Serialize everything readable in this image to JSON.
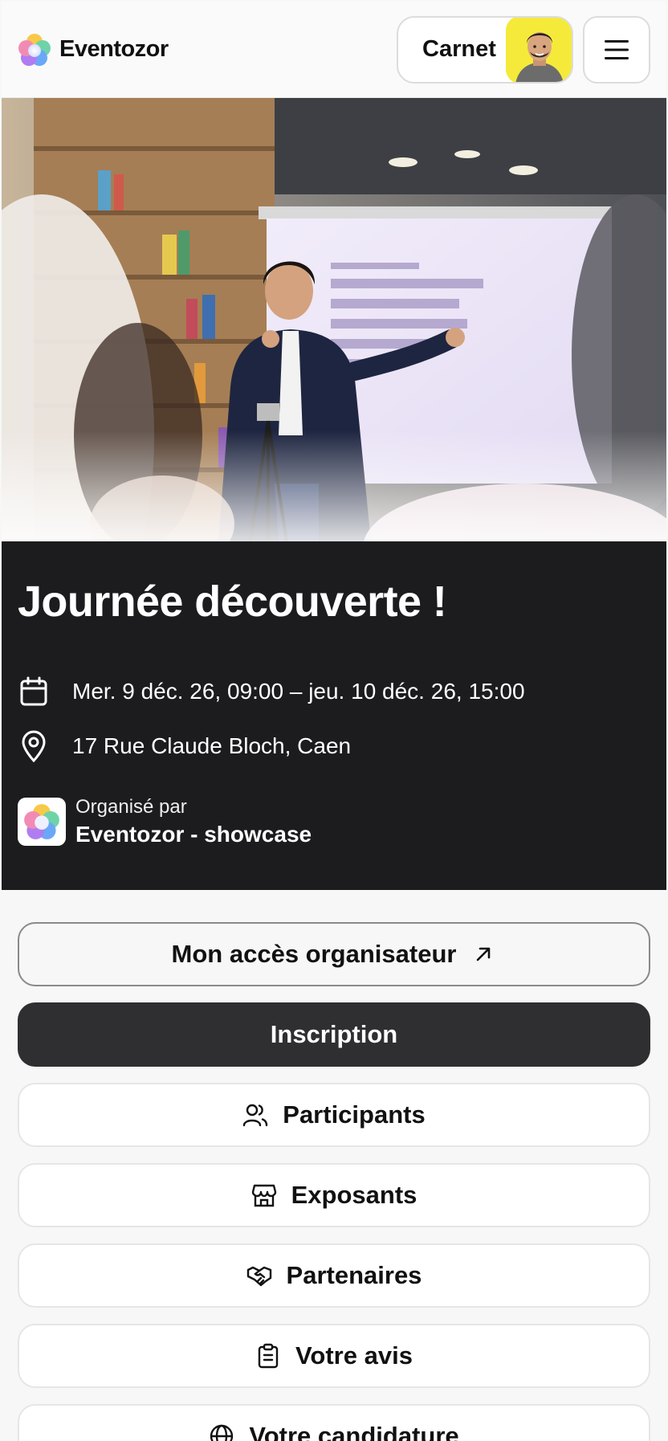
{
  "header": {
    "brand_name": "Eventozor",
    "carnet_label": "Carnet",
    "menu_icon": "hamburger-icon"
  },
  "event": {
    "title": "Journée découverte !",
    "date_range": "Mer. 9 déc. 26, 09:00 – jeu. 10 déc. 26, 15:00",
    "address": "17 Rue Claude Bloch, Caen",
    "organized_by_label": "Organisé par",
    "organizer_name": "Eventozor - showcase"
  },
  "actions": {
    "organizer_access": "Mon accès organisateur",
    "register": "Inscription",
    "participants": "Participants",
    "exhibitors": "Exposants",
    "partners": "Partenaires",
    "review": "Votre avis",
    "application": "Votre candidature"
  },
  "colors": {
    "dark_panel": "#1c1c1e",
    "dark_button": "#2f2f31",
    "avatar_bg": "#f5ea3a"
  }
}
